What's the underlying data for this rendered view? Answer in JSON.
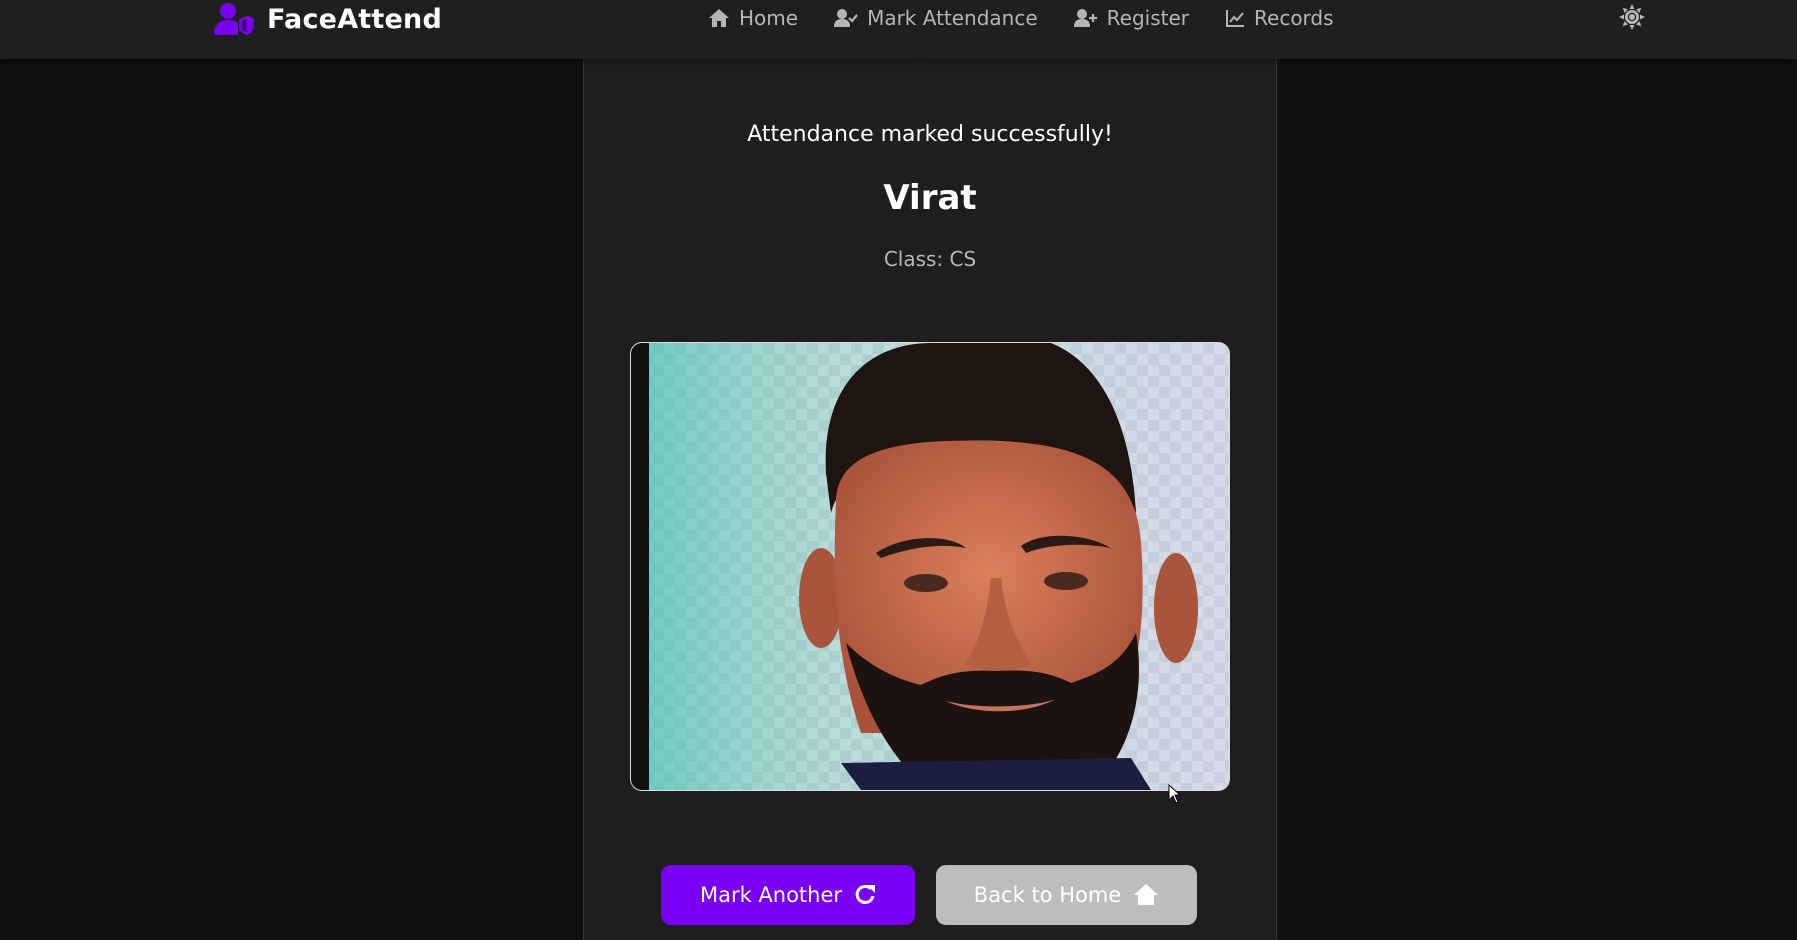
{
  "navbar": {
    "brand": "FaceAttend",
    "brand_icon": "user-shield-icon",
    "links": [
      {
        "label": "Home",
        "icon": "home-icon"
      },
      {
        "label": "Mark Attendance",
        "icon": "user-check-icon"
      },
      {
        "label": "Register",
        "icon": "user-plus-icon"
      },
      {
        "label": "Records",
        "icon": "chart-line-icon"
      }
    ],
    "theme_icon": "sun-icon"
  },
  "result": {
    "message": "Attendance marked successfully!",
    "name": "Virat",
    "class_label": "Class: CS"
  },
  "actions": {
    "primary_label": "Mark Another",
    "primary_icon": "redo-icon",
    "secondary_label": "Back to Home",
    "secondary_icon": "home-icon"
  },
  "colors": {
    "accent": "#7a00f5",
    "background": "#111111",
    "navbar": "#1f1f1f",
    "card": "#1e1e1e",
    "secondary_button": "#bdbdbd"
  }
}
